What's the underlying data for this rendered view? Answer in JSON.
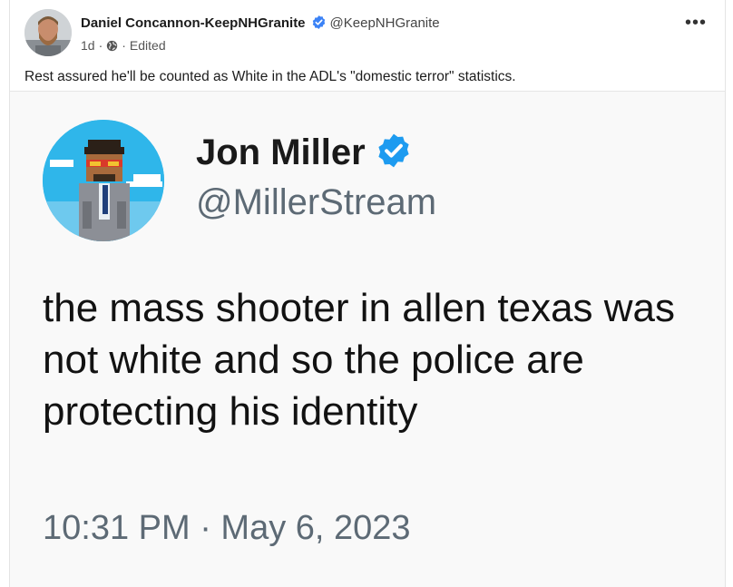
{
  "post": {
    "author_name": "Daniel Concannon-KeepNHGranite",
    "author_handle": "@KeepNHGranite",
    "time_ago": "1d",
    "edited_label": "Edited",
    "text": "Rest assured he'll be counted as White in the ADL's \"domestic terror\" statistics.",
    "more_label": "•••"
  },
  "embed": {
    "name": "Jon Miller",
    "handle": "@MillerStream",
    "body": "the mass shooter in allen texas was not white and so the police are protecting his identity",
    "timestamp": "10:31 PM · May 6, 2023"
  },
  "colors": {
    "verified_blue": "#1d9bf0",
    "verified_blue_small": "#3b82f6",
    "embed_background": "#f9f9f9",
    "muted_text": "#5d6a75"
  },
  "icons": [
    "verified-badge-icon",
    "globe-icon",
    "more-options-icon"
  ]
}
